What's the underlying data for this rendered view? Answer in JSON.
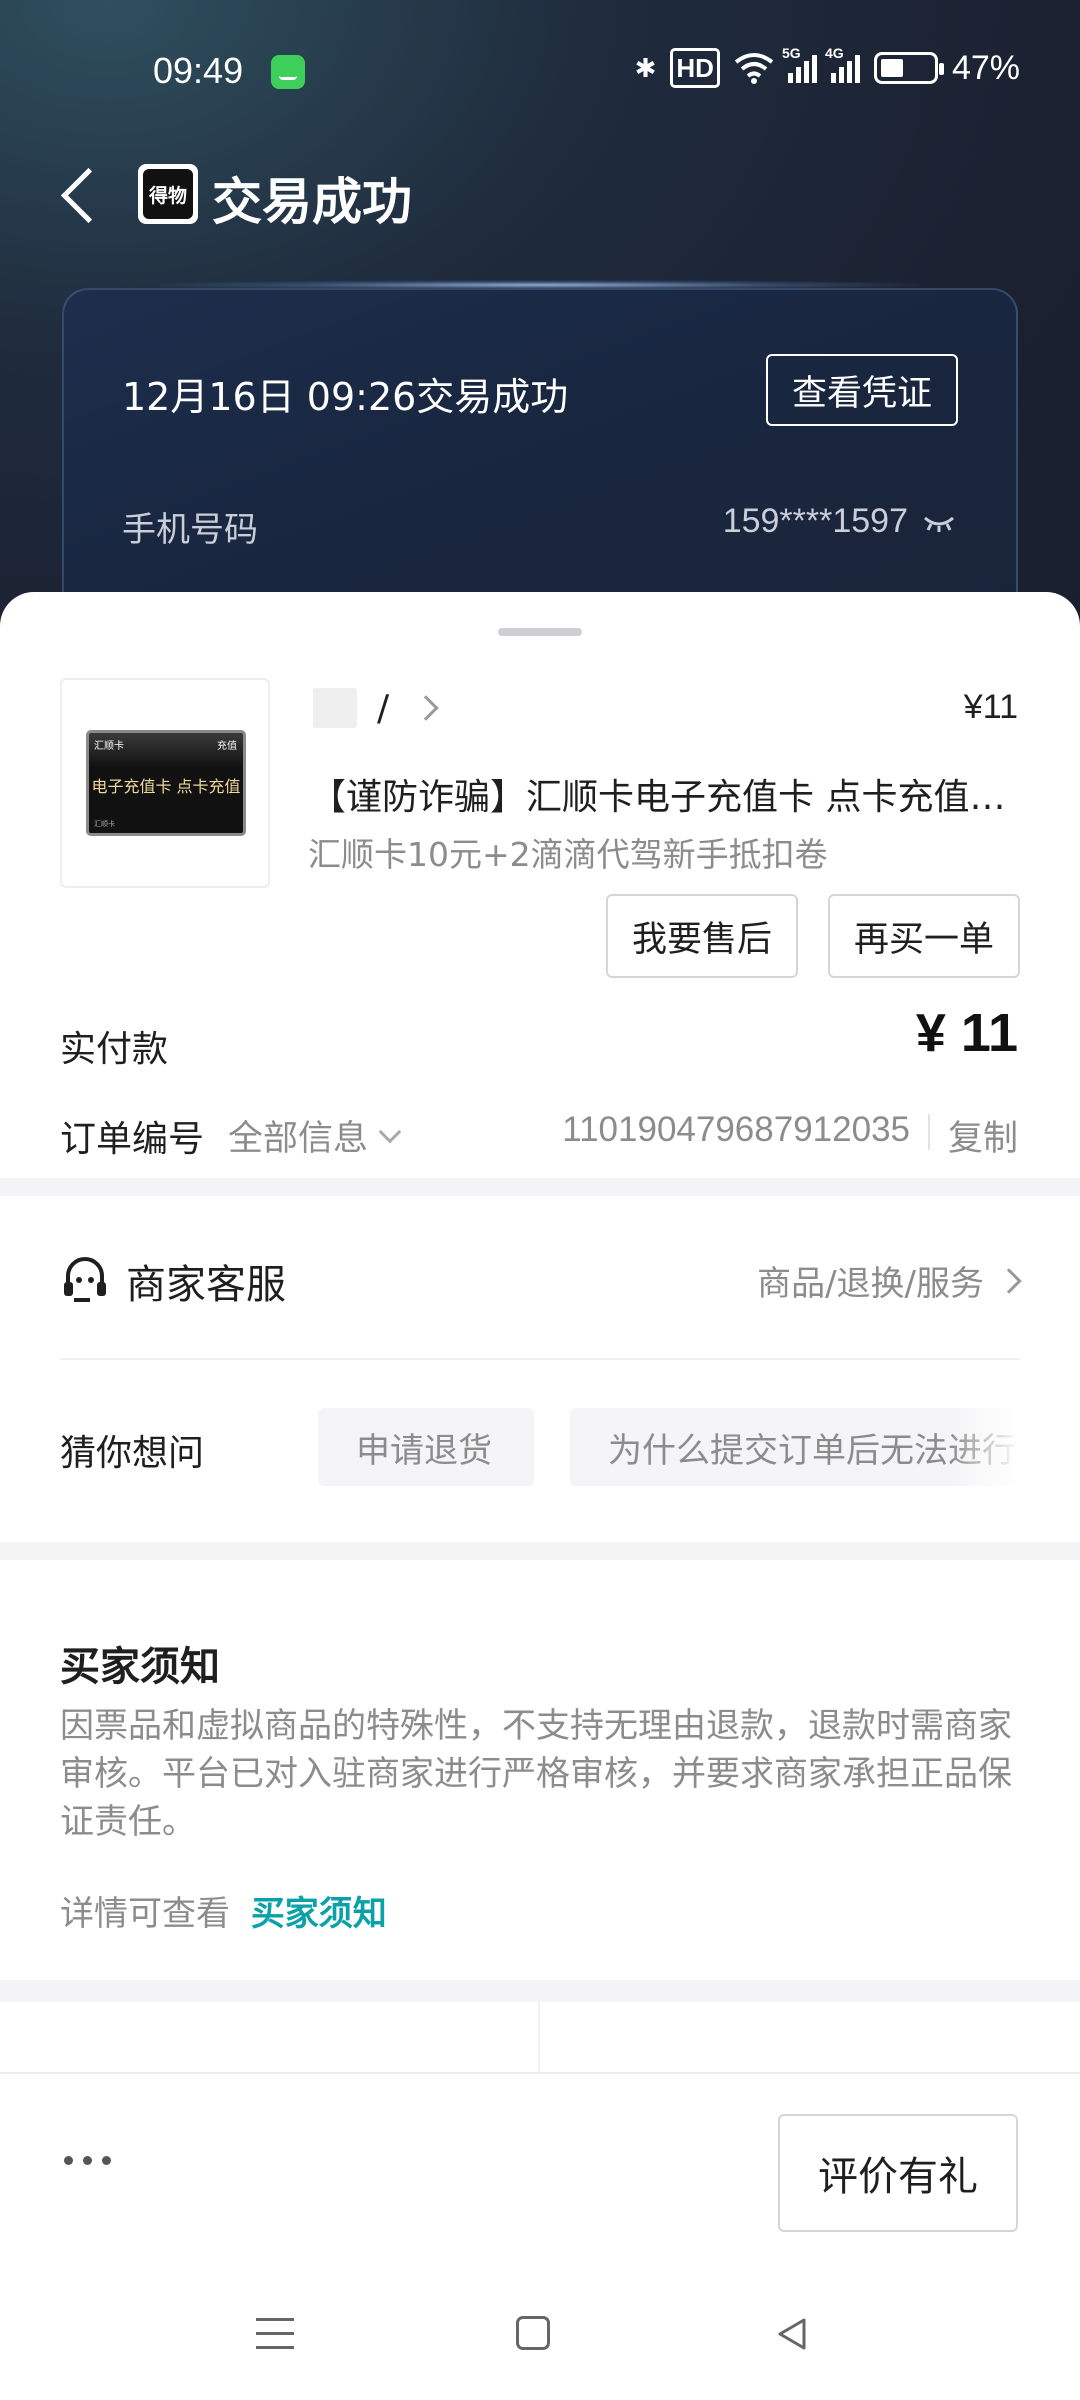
{
  "status_bar": {
    "time": "09:49",
    "hd_label": "HD",
    "net_5g": "5G",
    "net_4g": "4G",
    "battery": "47%"
  },
  "header": {
    "logo_text": "得物",
    "title": "交易成功"
  },
  "summary_card": {
    "datetime_status": "12月16日 09:26交易成功",
    "voucher_button": "查看凭证",
    "phone_label": "手机号码",
    "phone_value": "159****1597"
  },
  "product": {
    "shop_name": "/",
    "price": "¥11",
    "title": "【谨防诈骗】汇顺卡电子充值卡 点卡充值 ...",
    "spec": "汇顺卡10元+2滴滴代驾新手抵扣卷",
    "image_text": {
      "brand": "汇顺卡",
      "tag": "充值",
      "main": "电子充值卡 点卡充值",
      "footer": "汇顺卡"
    },
    "aftersale_button": "我要售后",
    "rebuy_button": "再买一单"
  },
  "payment": {
    "paid_label": "实付款",
    "paid_amount": "¥ 11"
  },
  "order": {
    "label": "订单编号",
    "all_info": "全部信息",
    "number": "110190479687912035",
    "copy": "复制"
  },
  "customer_service": {
    "title": "商家客服",
    "links": "商品/退换/服务"
  },
  "faq": {
    "label": "猜你想问",
    "chips": [
      "申请退货",
      "为什么提交订单后无法进行"
    ]
  },
  "notice": {
    "title": "买家须知",
    "body": "因票品和虚拟商品的特殊性，不支持无理由退款，退款时需商家审核。平台已对入驻商家进行严格审核，并要求商家承担正品保证责任。",
    "more_prefix": "详情可查看",
    "more_link": "买家须知"
  },
  "action_bar": {
    "review_button": "评价有礼"
  },
  "colors": {
    "accent_link": "#0aa2a8",
    "dark_bg": "#1b2131",
    "card_bg": "#192741"
  }
}
